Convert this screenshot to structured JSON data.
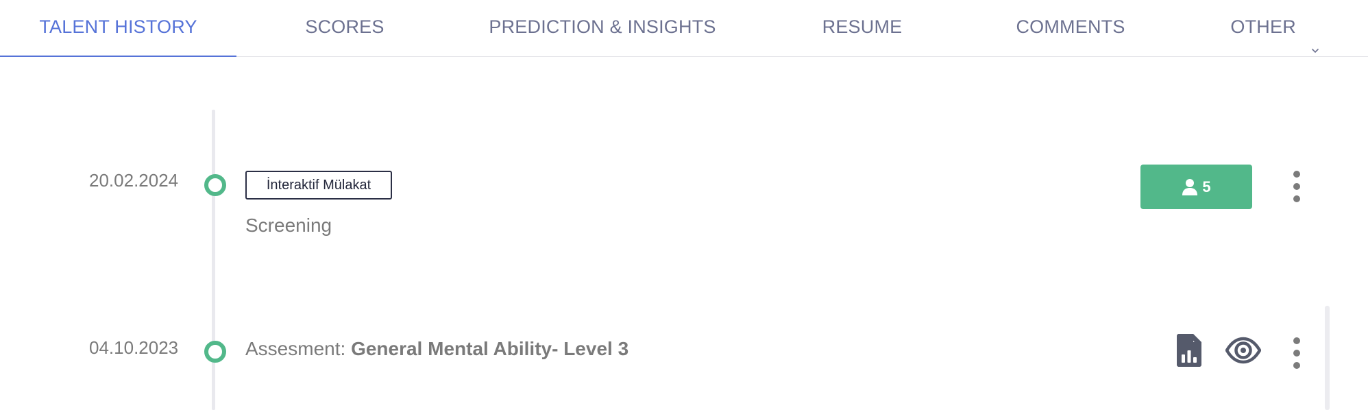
{
  "tabs": [
    {
      "label": "TALENT HISTORY",
      "active": true
    },
    {
      "label": "SCORES",
      "active": false
    },
    {
      "label": "PREDICTION & INSIGHTS",
      "active": false
    },
    {
      "label": "RESUME",
      "active": false
    },
    {
      "label": "COMMENTS",
      "active": false
    },
    {
      "label": "OTHER",
      "active": false,
      "icon": "chevron-down-icon"
    }
  ],
  "history": [
    {
      "date": "20.02.2024",
      "badge": "İnteraktif Mülakat",
      "stage": "Screening",
      "participants_count": "5",
      "participants_icon": "user-icon",
      "menu_icon": "more-vertical-icon"
    },
    {
      "date": "04.10.2023",
      "assessment_prefix": "Assesment: ",
      "assessment_name": "General Mental Ability- Level 3",
      "report_icon": "file-chart-icon",
      "view_icon": "eye-icon",
      "menu_icon": "more-vertical-icon"
    }
  ],
  "colors": {
    "accent": "#5673d8",
    "tab_text": "#6c7190",
    "success": "#52b88a",
    "muted_text": "#7a7a7a"
  }
}
